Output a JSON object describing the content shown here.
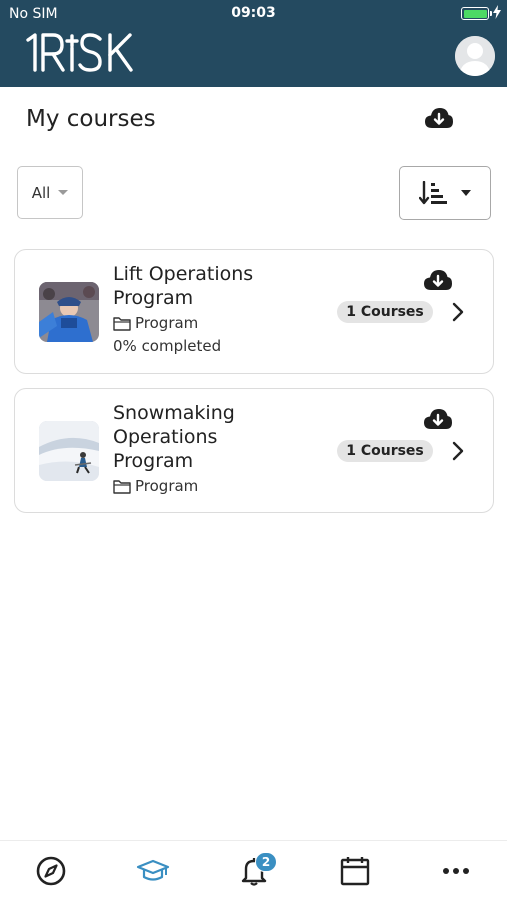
{
  "status_bar": {
    "carrier": "No SIM",
    "time": "09:03",
    "battery_level": 1.0
  },
  "header": {
    "logo_text": "1RiSK",
    "avatar_icon": "user-avatar-icon"
  },
  "page": {
    "title": "My courses",
    "download_icon": "cloud-download-icon"
  },
  "filters": {
    "selected": "All",
    "sort_icon": "sort-amount-down-icon"
  },
  "courses": [
    {
      "title_line1": "Lift Operations",
      "title_line2": "Program",
      "type": "Program",
      "progress_text": "0% completed",
      "badge": "1 Courses"
    },
    {
      "title_line1": "Snowmaking",
      "title_line2": "Operations",
      "title_line3": "Program",
      "type": "Program",
      "badge": "1 Courses"
    }
  ],
  "tab_bar": {
    "tabs": [
      {
        "icon": "compass-icon"
      },
      {
        "icon": "graduation-cap-icon",
        "active": true
      },
      {
        "icon": "bell-icon",
        "badge": "2"
      },
      {
        "icon": "calendar-icon"
      },
      {
        "icon": "more-icon"
      }
    ]
  },
  "colors": {
    "header_bg": "#244a60",
    "active_tab": "#3a8fc2",
    "badge_bg": "#e4e4e4"
  }
}
